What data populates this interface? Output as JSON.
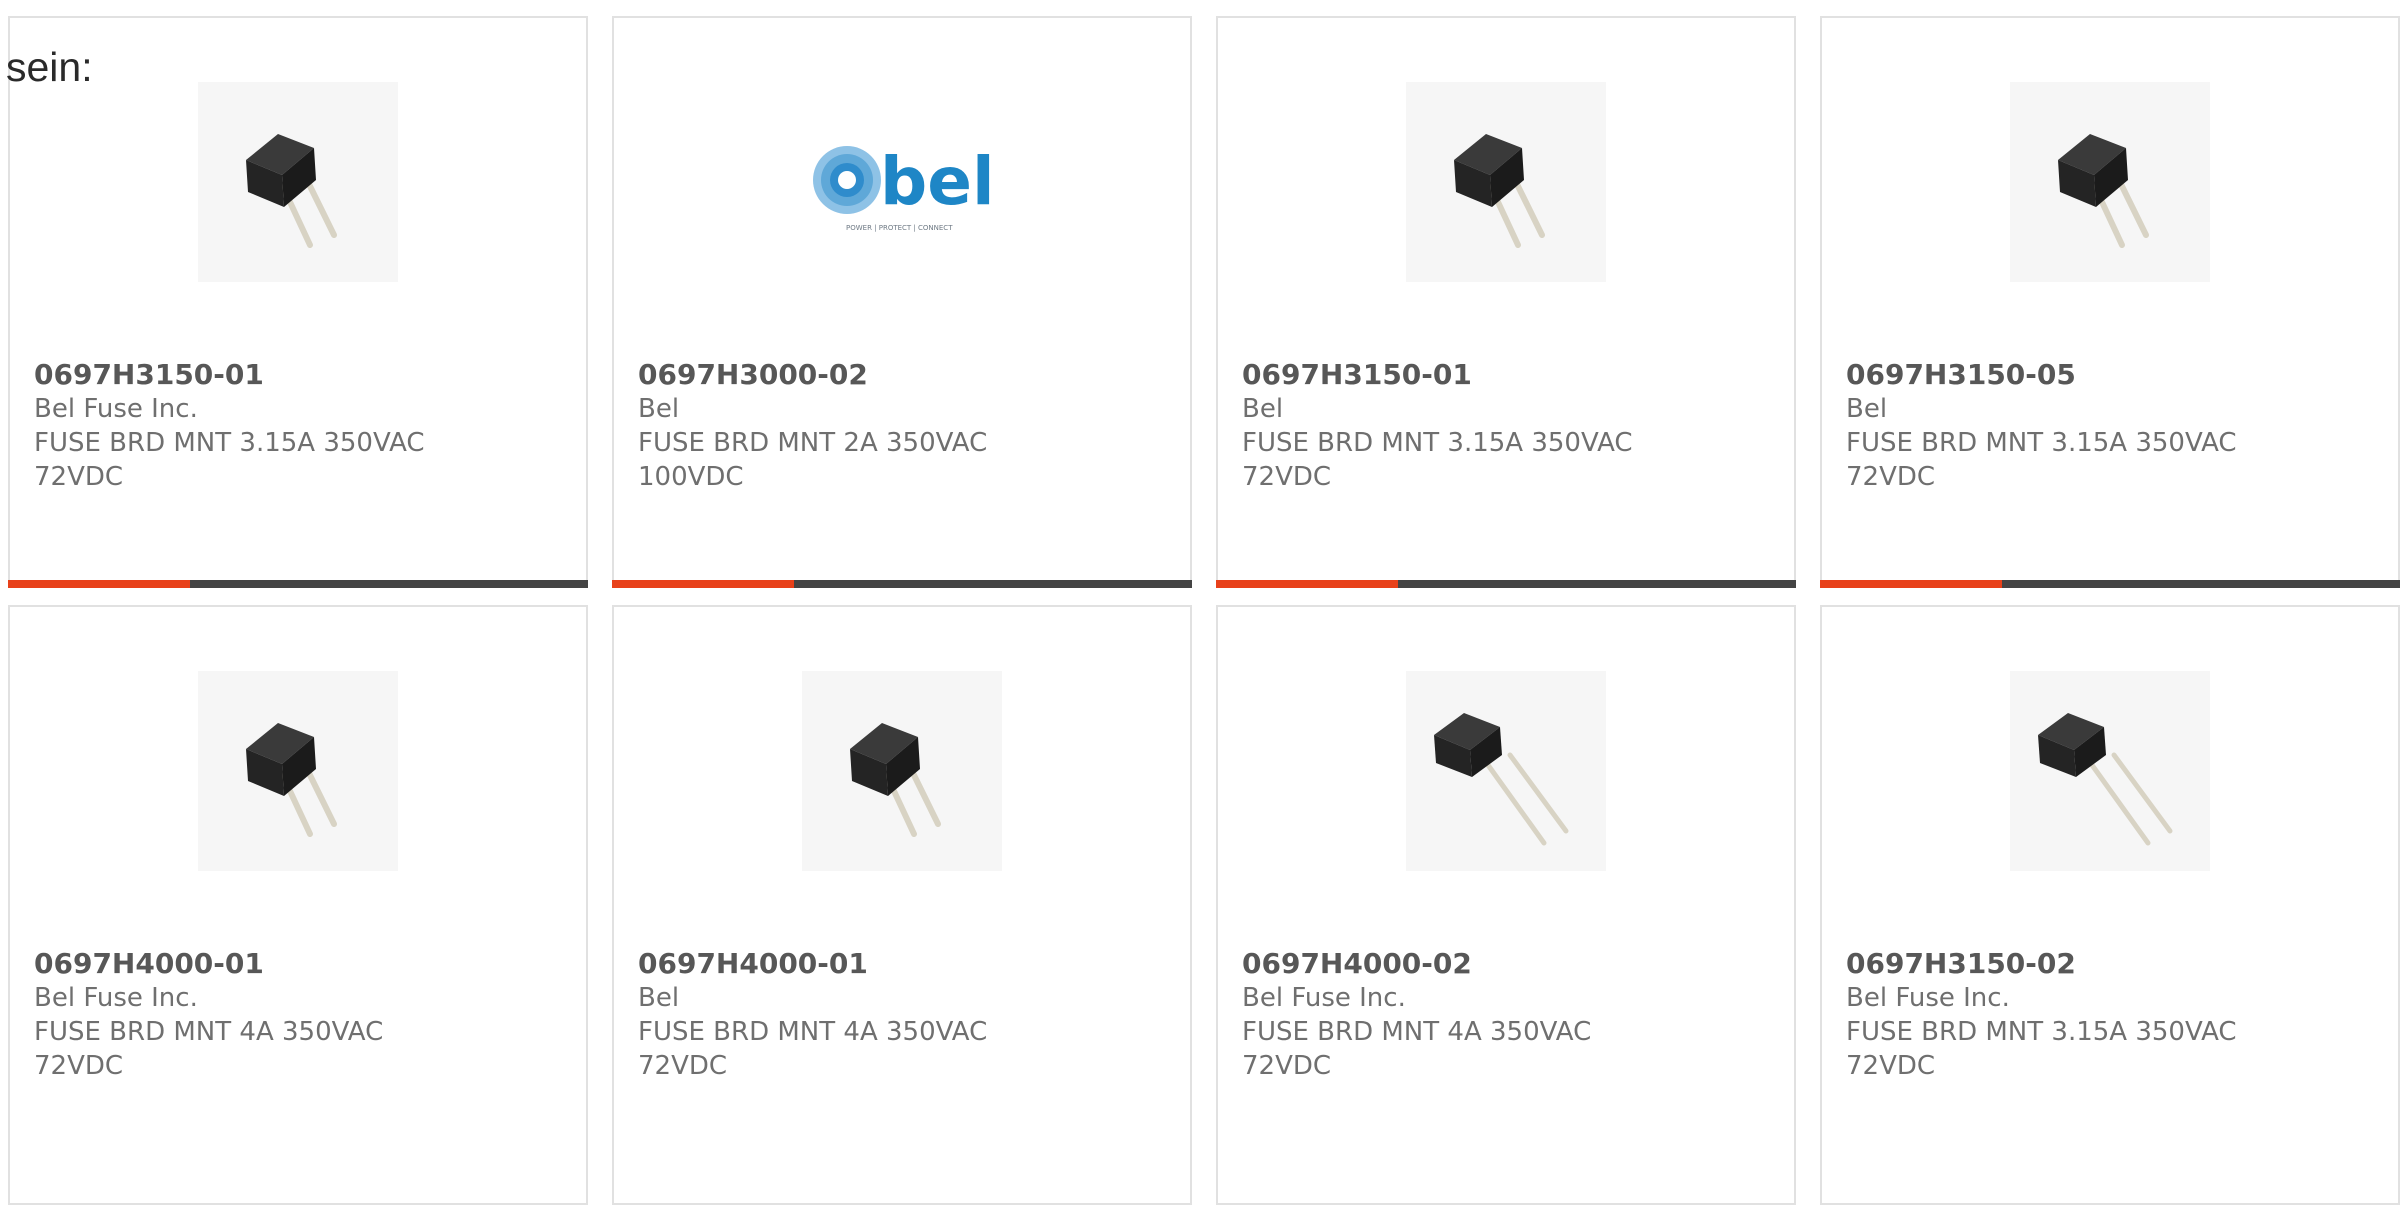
{
  "intro_text": "sein:",
  "colors": {
    "accent": "#e8411a",
    "bar_dark": "#444444",
    "card_border": "#e1e1e1",
    "text": "#6f6f6f",
    "part_text": "#575757",
    "bel_blue": "#1e86c6"
  },
  "products": [
    {
      "part": "0697H3150-01",
      "manufacturer": "Bel Fuse Inc.",
      "desc_line1": "FUSE BRD MNT 3.15A 350VAC",
      "desc_line2": "72VDC",
      "image": "fuse-image"
    },
    {
      "part": "0697H3000-02",
      "manufacturer": "Bel",
      "desc_line1": "FUSE BRD MNT 2A 350VAC",
      "desc_line2": "100VDC",
      "image": "bel-logo",
      "logo_text": "bel",
      "logo_tagline": "POWER | PROTECT | CONNECT"
    },
    {
      "part": "0697H3150-01",
      "manufacturer": "Bel",
      "desc_line1": "FUSE BRD MNT 3.15A 350VAC",
      "desc_line2": "72VDC",
      "image": "fuse-image"
    },
    {
      "part": "0697H3150-05",
      "manufacturer": "Bel",
      "desc_line1": "FUSE BRD MNT 3.15A 350VAC",
      "desc_line2": "72VDC",
      "image": "fuse-image"
    },
    {
      "part": "0697H4000-01",
      "manufacturer": "Bel Fuse Inc.",
      "desc_line1": "FUSE BRD MNT 4A 350VAC",
      "desc_line2": "72VDC",
      "image": "fuse-image"
    },
    {
      "part": "0697H4000-01",
      "manufacturer": "Bel",
      "desc_line1": "FUSE BRD MNT 4A 350VAC",
      "desc_line2": "72VDC",
      "image": "fuse-image"
    },
    {
      "part": "0697H4000-02",
      "manufacturer": "Bel Fuse Inc.",
      "desc_line1": "FUSE BRD MNT 4A 350VAC",
      "desc_line2": "72VDC",
      "image": "fuse-image-long-leads"
    },
    {
      "part": "0697H3150-02",
      "manufacturer": "Bel Fuse Inc.",
      "desc_line1": "FUSE BRD MNT 3.15A 350VAC",
      "desc_line2": "72VDC",
      "image": "fuse-image-long-leads"
    }
  ]
}
